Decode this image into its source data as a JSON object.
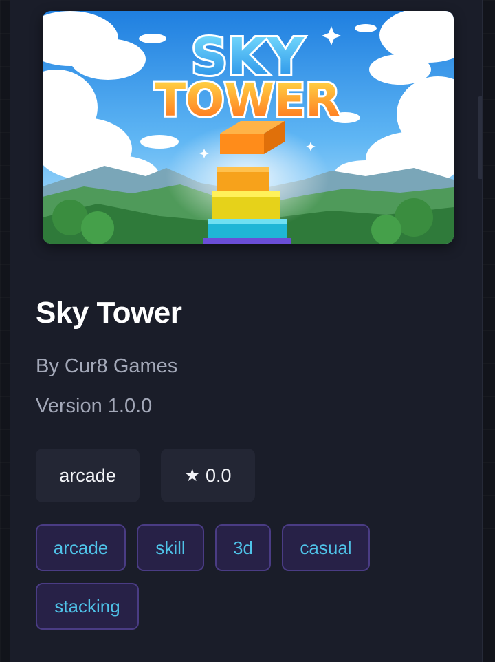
{
  "game": {
    "title": "Sky Tower",
    "author": "By Cur8 Games",
    "version": "Version 1.0.0",
    "category": "arcade",
    "rating": "0.0",
    "hero_logo_line1": "SKY",
    "hero_logo_line2": "TOWER"
  },
  "icons": {
    "rating": "star-icon"
  },
  "tags": [
    "arcade",
    "skill",
    "3d",
    "casual",
    "stacking"
  ],
  "colors": {
    "background": "#12141b",
    "card": "#1a1d29",
    "chip": "#232634",
    "tag_bg": "#272147",
    "tag_border": "#4a3c84",
    "tag_text": "#4fc3e8",
    "muted_text": "#a3a8b8"
  }
}
